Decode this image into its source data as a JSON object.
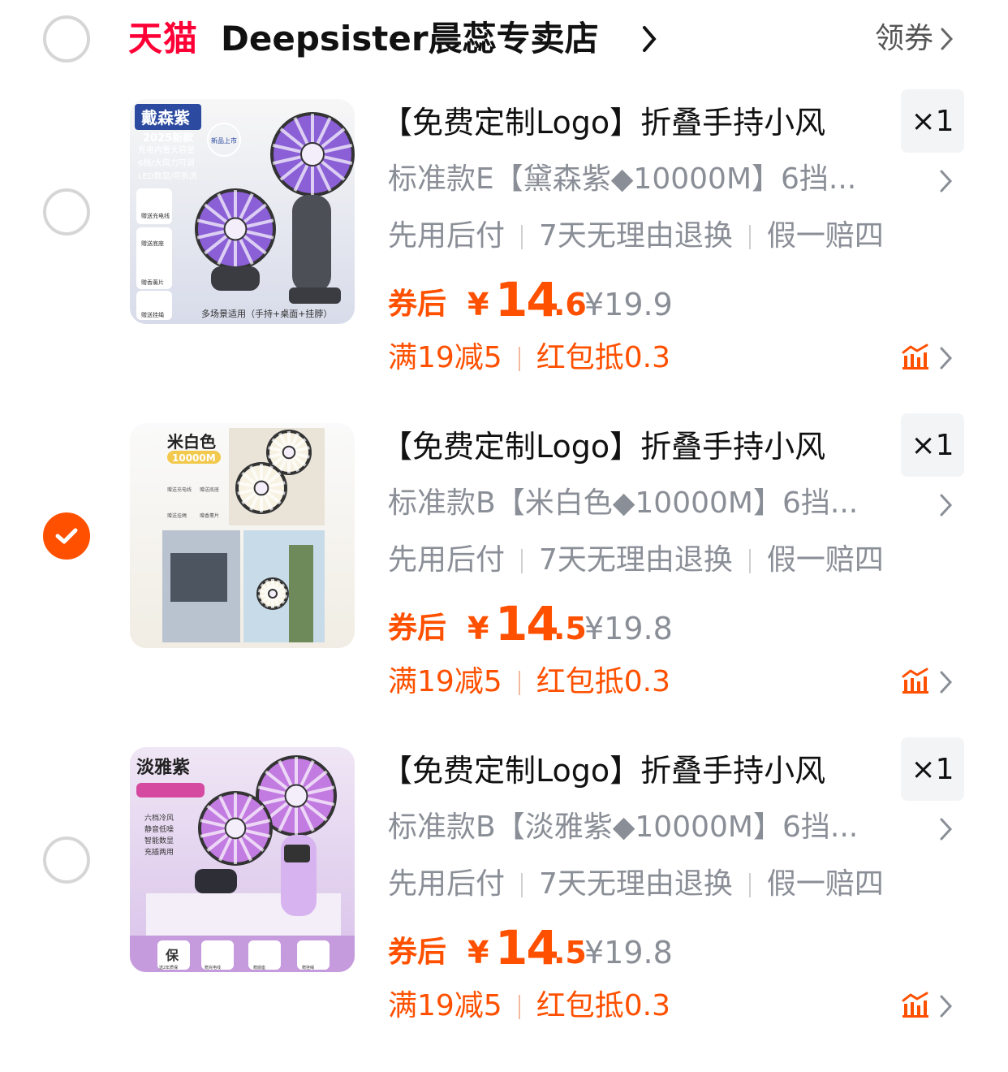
{
  "shop": {
    "tag": "天猫",
    "name": "Deepsister晨蕊专卖店",
    "coupon_label": "领券"
  },
  "items": [
    {
      "checked": false,
      "title": "【免费定制Logo】折叠手持小风",
      "qty": "×1",
      "sku": "标准款E【黛森紫◆10000M】6挡...",
      "services": [
        "先用后付",
        "7天无理由退换",
        "假一赔四"
      ],
      "price_label": "券后",
      "currency": "¥",
      "price_int": "14",
      "price_dec": ".6",
      "orig_price": "¥19.9",
      "promos": [
        "满19减5",
        "红包抵0.3"
      ],
      "thumb": {
        "bg_top": "#f7f7f7",
        "bg_bottom": "#d8dcea",
        "accent": "#8b5fd6",
        "tag": "戴森紫",
        "sub": "2025新款",
        "features": [
          "充电内置大容量",
          "6档/大风力可调",
          "LED数显/可拆洗"
        ],
        "gifts": [
          "赠送充电线",
          "赠送底座",
          "赠香薰片",
          "赠送挂绳"
        ],
        "caption": "多场景适用（手持+桌面+挂脖）",
        "seal": "新品上市"
      }
    },
    {
      "checked": true,
      "title": "【免费定制Logo】折叠手持小风",
      "qty": "×1",
      "sku": "标准款B【米白色◆10000M】6挡...",
      "services": [
        "先用后付",
        "7天无理由退换",
        "假一赔四"
      ],
      "price_label": "券后",
      "currency": "¥",
      "price_int": "14",
      "price_dec": ".5",
      "orig_price": "¥19.8",
      "promos": [
        "满19减5",
        "红包抵0.3"
      ],
      "thumb": {
        "bg_top": "#fafafa",
        "bg_bottom": "#f1ede4",
        "accent": "#f2c94c",
        "tag": "米白色",
        "sub": "10000M",
        "features": [],
        "gifts": [
          "赠送充电线",
          "赠送底座",
          "赠送挂绳",
          "赠香薰片"
        ],
        "caption": "",
        "seal": ""
      }
    },
    {
      "checked": false,
      "title": "【免费定制Logo】折叠手持小风",
      "qty": "×1",
      "sku": "标准款B【淡雅紫◆10000M】6挡...",
      "services": [
        "先用后付",
        "7天无理由退换",
        "假一赔四"
      ],
      "price_label": "券后",
      "currency": "¥",
      "price_int": "14",
      "price_dec": ".5",
      "orig_price": "¥19.8",
      "promos": [
        "满19减5",
        "红包抵0.3"
      ],
      "thumb": {
        "bg_top": "#efe6f5",
        "bg_bottom": "#d9c2ea",
        "accent": "#c27be0",
        "tag": "淡雅紫",
        "sub": "",
        "features": [
          "六档冷风",
          "静音低噪",
          "智能数显",
          "充插两用"
        ],
        "gifts": [
          "送2年质保",
          "赠充电线",
          "赠底座",
          "赠挂绳"
        ],
        "caption": "",
        "seal": "保"
      }
    }
  ],
  "colors": {
    "accent": "#ff5000",
    "tmall": "#ff0036",
    "muted": "#8a8e96"
  }
}
